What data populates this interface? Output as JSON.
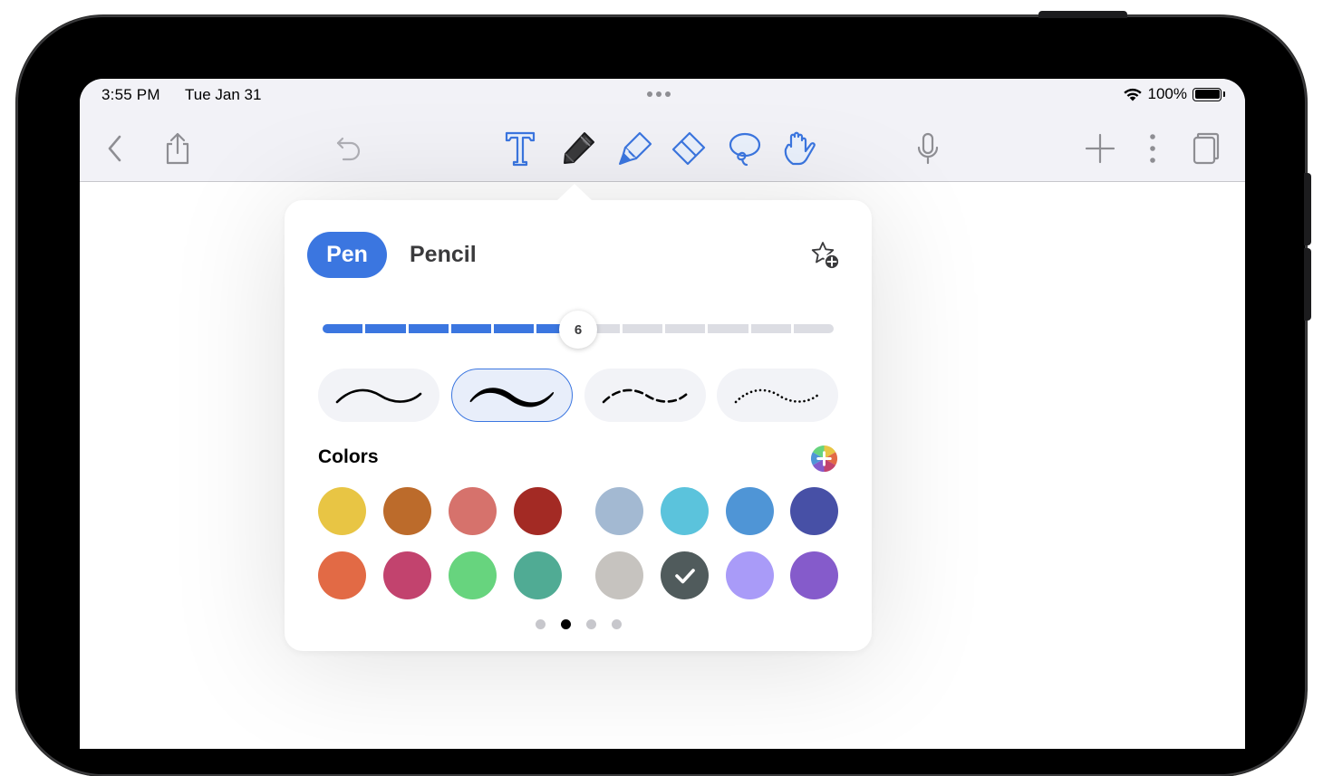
{
  "status_bar": {
    "time": "3:55 PM",
    "date": "Tue Jan 31",
    "battery": "100%"
  },
  "toolbar": {
    "left": [
      "chevron-left-icon",
      "share-icon",
      "undo-icon"
    ],
    "tools": [
      "text-tool-icon",
      "pen-tool-icon",
      "highlighter-tool-icon",
      "eraser-tool-icon",
      "lasso-tool-icon",
      "hand-tool-icon"
    ],
    "selected_tool": "pen-tool-icon",
    "right": [
      "microphone-icon",
      "plus-icon",
      "more-vertical-icon",
      "pages-icon"
    ],
    "accent": "#3b76e0"
  },
  "popover": {
    "tabs": [
      {
        "label": "Pen",
        "selected": true
      },
      {
        "label": "Pencil",
        "selected": false
      }
    ],
    "favorite_icon": "star-add-icon",
    "thickness": {
      "value": "6",
      "segments": 12,
      "filled": 6
    },
    "stroke_styles": [
      {
        "name": "smooth-thin",
        "selected": false
      },
      {
        "name": "pressure",
        "selected": true
      },
      {
        "name": "dashed",
        "selected": false
      },
      {
        "name": "dotted",
        "selected": false
      }
    ],
    "colors_label": "Colors",
    "color_wheel_icon": "color-wheel-add-icon",
    "colors": [
      [
        "#e8c544",
        "#bc6b2b",
        "#d6726c",
        "#a32a24",
        "#a3b9d2",
        "#5bc3dc",
        "#4f95d6",
        "#4750a6"
      ],
      [
        "#e26a45",
        "#c2436e",
        "#67d47e",
        "#50ab94",
        "#c6c3bf",
        "#505b5c",
        "#a99bf8",
        "#855bcb"
      ]
    ],
    "selected_color": "#505b5c",
    "pages": 4,
    "current_page": 1
  }
}
